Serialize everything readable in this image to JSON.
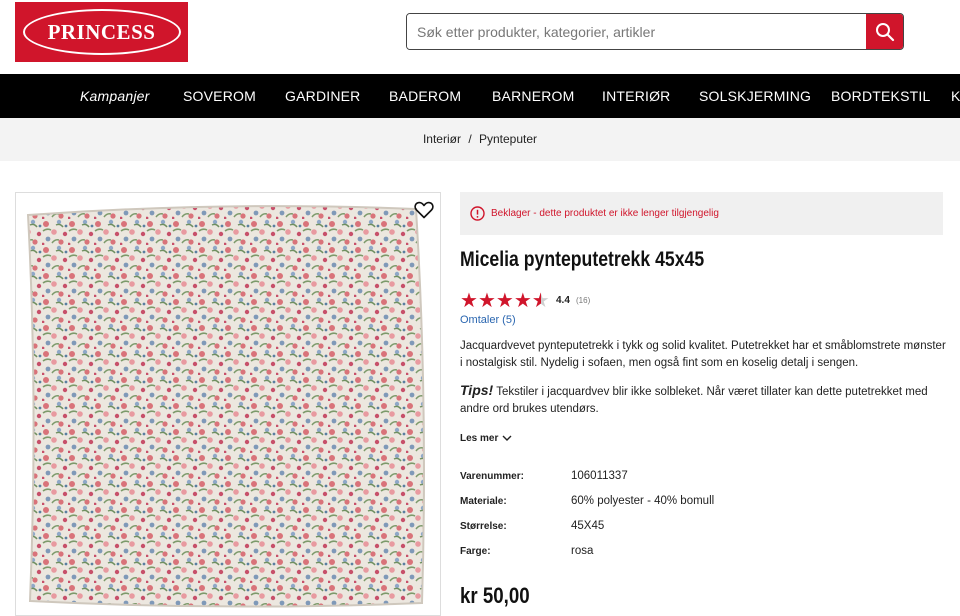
{
  "brand": {
    "name": "PRINCESS"
  },
  "search": {
    "placeholder": "Søk etter produkter, kategorier, artikler"
  },
  "nav": {
    "items": [
      {
        "label": "Kampanjer"
      },
      {
        "label": "SOVEROM"
      },
      {
        "label": "GARDINER"
      },
      {
        "label": "BADEROM"
      },
      {
        "label": "BARNEROM"
      },
      {
        "label": "INTERIØR"
      },
      {
        "label": "SOLSKJERMING"
      },
      {
        "label": "BORDTEKSTIL"
      },
      {
        "label": "K"
      }
    ]
  },
  "breadcrumb": {
    "parent": "Interiør",
    "separator": "/",
    "current": "Pynteputer"
  },
  "alert": {
    "text": "Beklager - dette produktet er ikke lenger tilgjengelig"
  },
  "product": {
    "title": "Micelia pynteputetrekk 45x45",
    "rating": {
      "value": 4.4,
      "value_text": "4.4",
      "count_text": "(16)",
      "max": 5
    },
    "reviews_link": "Omtaler (5)",
    "description": "Jacquardvevet pynteputetrekk i tykk og solid kvalitet. Putetrekket har et småblomstrete mønster i nostalgisk stil. Nydelig i sofaen, men også fint som en koselig detalj i sengen.",
    "tips_label": "Tips!",
    "tips_text": " Tekstiler i jacquardvev blir ikke solbleket. Når været tillater kan dette putetrekket med andre ord brukes utendørs.",
    "read_more": "Les mer",
    "specs": [
      {
        "label": "Varenummer:",
        "value": "106011337"
      },
      {
        "label": "Materiale:",
        "value": "60% polyester - 40% bomull"
      },
      {
        "label": "Størrelse:",
        "value": "45X45"
      },
      {
        "label": "Farge:",
        "value": "rosa"
      }
    ],
    "price": "kr 50,00"
  },
  "colors": {
    "brand_red": "#d0152b",
    "nav_bg": "#000000",
    "link": "#2a66b0"
  }
}
